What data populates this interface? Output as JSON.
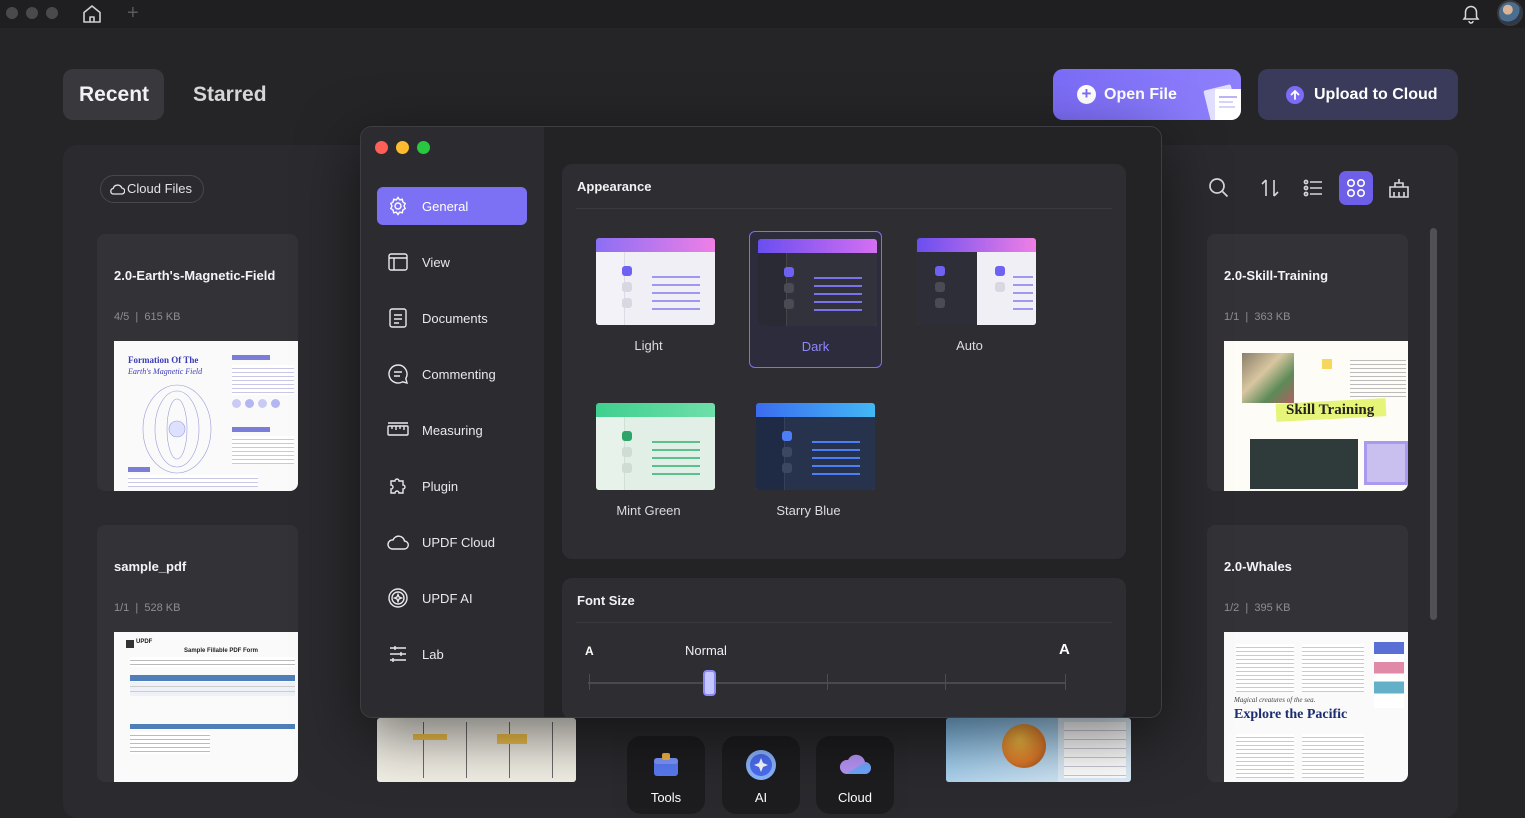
{
  "titlebar": {
    "new_tab_symbol": "+"
  },
  "tabs": {
    "recent": "Recent",
    "starred": "Starred"
  },
  "actions": {
    "open_file": "Open File",
    "upload_to_cloud": "Upload to Cloud",
    "open_file_plus": "+"
  },
  "cloud_files": {
    "label": "Cloud Files"
  },
  "cards": [
    {
      "title": "2.0-Earth's-Magnetic-Field",
      "pages": "4/5",
      "size": "615 KB",
      "thumb_text": {
        "heading": "Formation Of The",
        "subheading": "Earth's Magnetic Field"
      }
    },
    {
      "title": "sample_pdf",
      "pages": "1/1",
      "size": "528 KB",
      "thumb_text": {
        "logo": "UPDF",
        "heading": "Sample Fillable PDF Form"
      }
    },
    {
      "title": "2.0-Skill-Training",
      "pages": "1/1",
      "size": "363 KB",
      "thumb_text": {
        "banner": "Skill Training"
      }
    },
    {
      "title": "2.0-Whales",
      "pages": "1/2",
      "size": "395 KB",
      "thumb_text": {
        "tagline": "Magical creatures of the sea.",
        "heading": "Explore the Pacific"
      }
    }
  ],
  "dock": [
    {
      "label": "Tools",
      "icon": "tools-icon"
    },
    {
      "label": "AI",
      "icon": "ai-icon"
    },
    {
      "label": "Cloud",
      "icon": "cloud-icon"
    }
  ],
  "settings": {
    "nav": [
      {
        "label": "General",
        "icon": "gear-icon",
        "active": true
      },
      {
        "label": "View",
        "icon": "window-icon"
      },
      {
        "label": "Documents",
        "icon": "document-icon"
      },
      {
        "label": "Commenting",
        "icon": "comment-icon"
      },
      {
        "label": "Measuring",
        "icon": "ruler-icon"
      },
      {
        "label": "Plugin",
        "icon": "puzzle-icon"
      },
      {
        "label": "UPDF Cloud",
        "icon": "cloud-icon"
      },
      {
        "label": "UPDF AI",
        "icon": "ai-icon"
      },
      {
        "label": "Lab",
        "icon": "sliders-icon"
      }
    ],
    "appearance": {
      "title": "Appearance",
      "themes": [
        {
          "label": "Light",
          "selected": false
        },
        {
          "label": "Dark",
          "selected": true
        },
        {
          "label": "Auto",
          "selected": false
        },
        {
          "label": "Mint Green",
          "selected": false
        },
        {
          "label": "Starry Blue",
          "selected": false
        }
      ]
    },
    "font_size": {
      "title": "Font Size",
      "small_label": "A",
      "large_label": "A",
      "value_label": "Normal",
      "step_index": 1,
      "step_count": 5
    }
  },
  "colors": {
    "accent": "#7c70f4",
    "background": "#252528",
    "window": "#2a2a2e",
    "close": "#fe5f57",
    "minimize": "#febc2e",
    "maximize": "#28c840"
  }
}
